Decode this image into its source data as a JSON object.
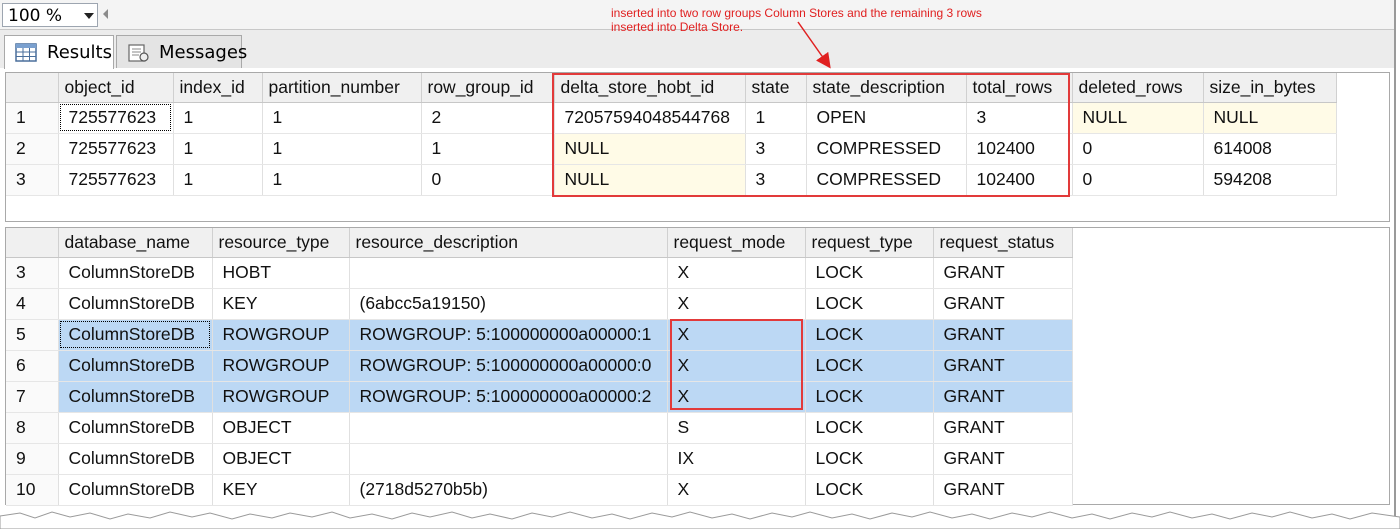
{
  "zoom": {
    "value": "100 %"
  },
  "tabs": [
    {
      "label": "Results",
      "icon": "grid-icon"
    },
    {
      "label": "Messages",
      "icon": "messages-icon"
    }
  ],
  "annotation": {
    "line1": "inserted into two row groups Column Stores and the remaining 3 rows",
    "line2": "inserted into Delta Store."
  },
  "grid1": {
    "columns": [
      "object_id",
      "index_id",
      "partition_number",
      "row_group_id",
      "delta_store_hobt_id",
      "state",
      "state_description",
      "total_rows",
      "deleted_rows",
      "size_in_bytes"
    ],
    "rows": [
      {
        "rn": "1",
        "cells": [
          "725577623",
          "1",
          "1",
          "2",
          "72057594048544768",
          "1",
          "OPEN",
          "3",
          "NULL",
          "NULL"
        ]
      },
      {
        "rn": "2",
        "cells": [
          "725577623",
          "1",
          "1",
          "1",
          "NULL",
          "3",
          "COMPRESSED",
          "102400",
          "0",
          "614008"
        ]
      },
      {
        "rn": "3",
        "cells": [
          "725577623",
          "1",
          "1",
          "0",
          "NULL",
          "3",
          "COMPRESSED",
          "102400",
          "0",
          "594208"
        ]
      }
    ]
  },
  "grid2": {
    "columns": [
      "database_name",
      "resource_type",
      "resource_description",
      "request_mode",
      "request_type",
      "request_status"
    ],
    "rows": [
      {
        "rn": "3",
        "cells": [
          "ColumnStoreDB",
          "HOBT",
          "",
          "X",
          "LOCK",
          "GRANT"
        ]
      },
      {
        "rn": "4",
        "cells": [
          "ColumnStoreDB",
          "KEY",
          "(6abcc5a19150)",
          "X",
          "LOCK",
          "GRANT"
        ]
      },
      {
        "rn": "5",
        "cells": [
          "ColumnStoreDB",
          "ROWGROUP",
          "ROWGROUP: 5:100000000a00000:1",
          "X",
          "LOCK",
          "GRANT"
        ]
      },
      {
        "rn": "6",
        "cells": [
          "ColumnStoreDB",
          "ROWGROUP",
          "ROWGROUP: 5:100000000a00000:0",
          "X",
          "LOCK",
          "GRANT"
        ]
      },
      {
        "rn": "7",
        "cells": [
          "ColumnStoreDB",
          "ROWGROUP",
          "ROWGROUP: 5:100000000a00000:2",
          "X",
          "LOCK",
          "GRANT"
        ]
      },
      {
        "rn": "8",
        "cells": [
          "ColumnStoreDB",
          "OBJECT",
          "",
          "S",
          "LOCK",
          "GRANT"
        ]
      },
      {
        "rn": "9",
        "cells": [
          "ColumnStoreDB",
          "OBJECT",
          "",
          "IX",
          "LOCK",
          "GRANT"
        ]
      },
      {
        "rn": "10",
        "cells": [
          "ColumnStoreDB",
          "KEY",
          "(2718d5270b5b)",
          "X",
          "LOCK",
          "GRANT"
        ]
      }
    ]
  },
  "colors": {
    "annotation": "#e02020",
    "selection": "#bcd8f4",
    "null_cell": "#fffbe7"
  }
}
